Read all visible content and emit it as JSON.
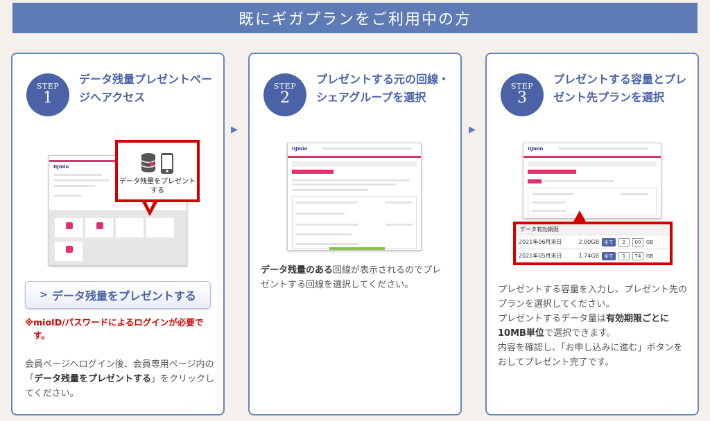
{
  "banner": {
    "title": "既にギガプランをご利用中の方"
  },
  "steps": [
    {
      "label": "STEP",
      "number": "1",
      "title": "データ残量プレゼントページへアクセス",
      "callout_text": "データ残量をプレゼントする",
      "cta_label": "データ残量をプレゼントする",
      "note": "※mioID/パスワードによるログインが必要です。",
      "desc_a": "会員ページへログイン後、会員専用ページ内の「",
      "desc_b": "データ残量をプレゼントする",
      "desc_c": "」をクリックしてください。"
    },
    {
      "label": "STEP",
      "number": "2",
      "title": "プレゼントする元の回線・シェアグループを選択",
      "desc_a": "データ残量のある",
      "desc_b": "回線が表示されるのでプレゼントする回線を選択してください。"
    },
    {
      "label": "STEP",
      "number": "3",
      "title": "プレゼントする容量とプレゼント先プランを選択",
      "table": {
        "header": "データ有効期限",
        "rows": [
          {
            "date": "2021年06月末日",
            "amount": "2.00GB",
            "btn": "全て",
            "int": "2",
            "dec": "00",
            "unit": "GB"
          },
          {
            "date": "2021年05月末日",
            "amount": "1.74GB",
            "btn": "全て",
            "int": "1",
            "dec": "74",
            "unit": "GB"
          }
        ]
      },
      "desc_a": "プレゼントする容量を入力し、プレゼント先のプランを選択してください。",
      "desc_b": "プレゼントするデータ量は",
      "desc_c": "有効期限ごとに10MB単位",
      "desc_d": "で選択できます。",
      "desc_e": "内容を確認し、「お申し込みに進む」ボタンをおしてプレゼント完了です。"
    }
  ],
  "colors": {
    "accent": "#4b63a6",
    "banner": "#5e7bb5",
    "alert": "#d40000",
    "brand_pink": "#e0306f"
  },
  "icons": {
    "arrow": "right-triangle",
    "chevron": "chevron-right",
    "db": "database-icon",
    "phone": "smartphone-icon"
  }
}
